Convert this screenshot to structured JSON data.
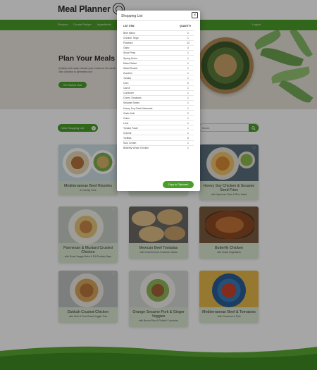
{
  "app": {
    "logo_text": "Meal Planner"
  },
  "nav": {
    "links": [
      "Recipes",
      "Create Recipe",
      "Ingredients",
      "Logout"
    ]
  },
  "hero": {
    "title": "Plan Your Meals Fa",
    "description": "Quickly and easily choose your meals for the week, then join click a button to generate your",
    "cta_label": "Get Started Now"
  },
  "toolbar": {
    "shopping_list_label": "View Shopping List",
    "shopping_list_count": "4",
    "search_placeholder": "Search"
  },
  "recipes": [
    {
      "title": "Mediterranean Beef Rissoles",
      "subtitle": "& Cheesy Fries"
    },
    {
      "title": "",
      "subtitle": ""
    },
    {
      "title": "Honey Soy Chicken & Sesame Seed Fries",
      "subtitle": "with Japanese Slaw & Rice Salad"
    },
    {
      "title": "Parmesan & Mustard Crusted Chicken",
      "subtitle": "with Roast Veggie Bake & Dill-Parsley Mayo"
    },
    {
      "title": "Mexican Beef Tostadas",
      "subtitle": "with Charred Corn-Coriander Salsa"
    },
    {
      "title": "Butterfly Chicken",
      "subtitle": "with Roast Vegetables"
    },
    {
      "title": "Dukkah Crusted Chicken",
      "subtitle": "with Herb & Feta Roast Veggie Toss"
    },
    {
      "title": "Orange Sesame Pork & Ginger Veggies",
      "subtitle": "with Brown Rice & Pickled Cucumber"
    },
    {
      "title": "Mediterranean Beef & Tomatoes",
      "subtitle": "with Couscous & Feta"
    }
  ],
  "modal": {
    "title": "Shopping List",
    "close_icon": "×",
    "col_item": "LIST ITEM",
    "col_qty": "QUANTITY",
    "items": [
      {
        "name": "Beef Mince",
        "qty": "2"
      },
      {
        "name": "Chicken Thigh",
        "qty": "1"
      },
      {
        "name": "Potatoes",
        "qty": "13"
      },
      {
        "name": "Garlic",
        "qty": "4"
      },
      {
        "name": "Snow Peas",
        "qty": "1"
      },
      {
        "name": "Spring Onion",
        "qty": "1"
      },
      {
        "name": "Mixed Salad",
        "qty": "1"
      },
      {
        "name": "Salad Rocket",
        "qty": "1"
      },
      {
        "name": "Zucchini",
        "qty": "1"
      },
      {
        "name": "Tomato",
        "qty": "1"
      },
      {
        "name": "Corn",
        "qty": "2"
      },
      {
        "name": "Carrot",
        "qty": "1"
      },
      {
        "name": "Coriander",
        "qty": "1"
      },
      {
        "name": "Cherry Tomatoes",
        "qty": "1"
      },
      {
        "name": "Sesame Seeds",
        "qty": "1"
      },
      {
        "name": "Honey Soy Garlic Marinade",
        "qty": "1"
      },
      {
        "name": "Garlic Aioli",
        "qty": "2"
      },
      {
        "name": "Onion",
        "qty": "1"
      },
      {
        "name": "Lime",
        "qty": "1"
      },
      {
        "name": "Tomato Paste",
        "qty": "1"
      },
      {
        "name": "Cheese",
        "qty": "1"
      },
      {
        "name": "Tortillas",
        "qty": "6"
      },
      {
        "name": "Sour Cream",
        "qty": "1"
      },
      {
        "name": "Butterfly Whole Chicken",
        "qty": "1"
      }
    ],
    "copy_label": "Copy to Clipboard"
  },
  "colors": {
    "accent": "#4a9e2a",
    "card_bg": "#dbe9d2",
    "overlay": "rgba(0,0,0,0.35)"
  }
}
